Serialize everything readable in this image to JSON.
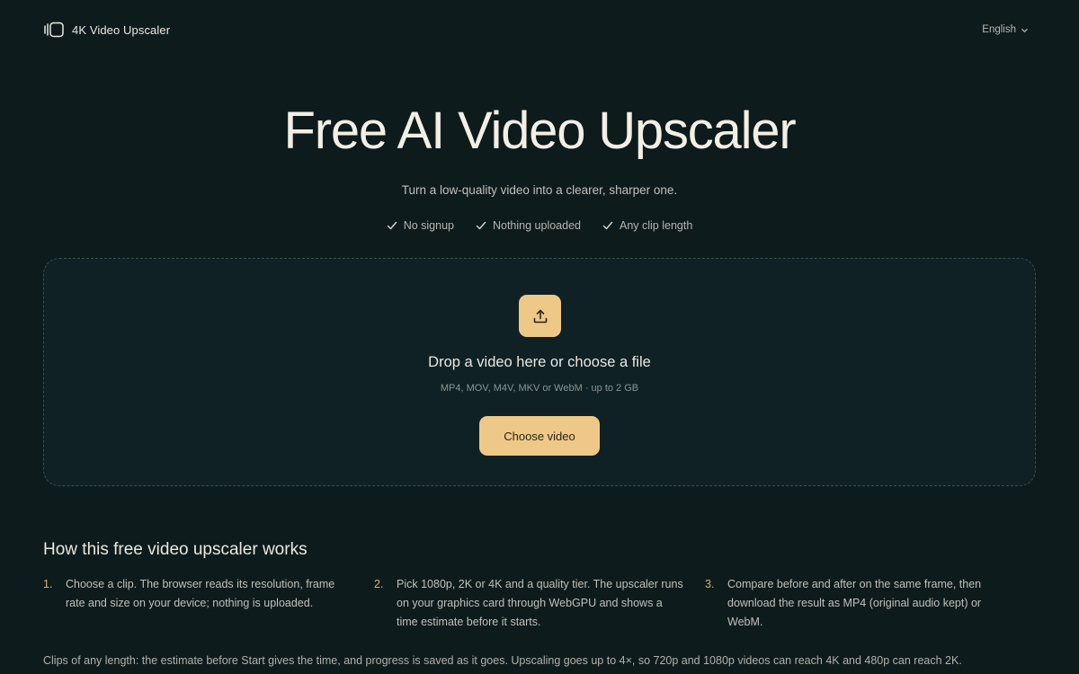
{
  "header": {
    "brand_name": "4K Video Upscaler",
    "language": "English"
  },
  "hero": {
    "title": "Free AI Video Upscaler",
    "subtitle": "Turn a low-quality video into a clearer, sharper one.",
    "features": [
      "No signup",
      "Nothing uploaded",
      "Any clip length"
    ]
  },
  "dropzone": {
    "title": "Drop a video here or choose a file",
    "hint": "MP4, MOV, M4V, MKV or WebM · up to 2 GB",
    "button_label": "Choose video"
  },
  "how": {
    "title": "How this free video upscaler works",
    "steps": [
      {
        "num": "1.",
        "text": "Choose a clip. The browser reads its resolution, frame rate and size on your device; nothing is uploaded."
      },
      {
        "num": "2.",
        "text": "Pick 1080p, 2K or 4K and a quality tier. The upscaler runs on your graphics card through WebGPU and shows a time estimate before it starts."
      },
      {
        "num": "3.",
        "text": "Compare before and after on the same frame, then download the result as MP4 (original audio kept) or WebM."
      }
    ],
    "footnote": "Clips of any length: the estimate before Start gives the time, and progress is saved as it goes. Upscaling goes up to 4×, so 720p and 1080p videos can reach 4K and 480p can reach 2K."
  },
  "colors": {
    "background": "#0d1b1c",
    "dropzone_bg": "#0f2124",
    "accent": "#eec887",
    "step_number": "#d9b36e"
  },
  "icons": {
    "brand": "video-frame-icon",
    "language": "chevron-down-icon",
    "feature": "check-icon",
    "upload": "upload-icon"
  }
}
